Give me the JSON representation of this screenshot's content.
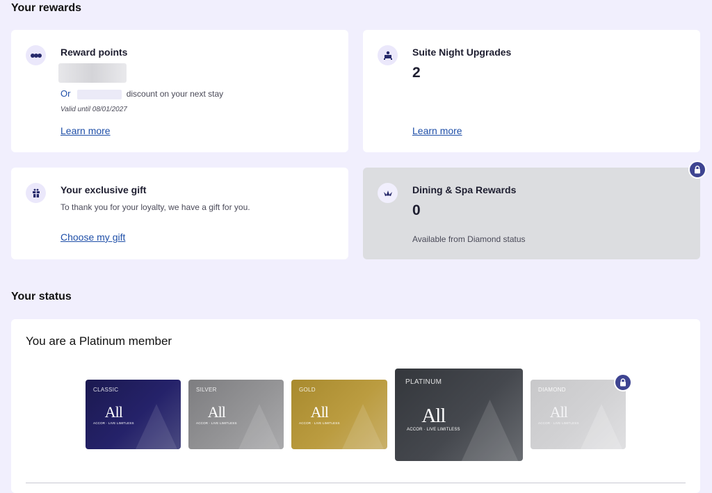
{
  "rewards": {
    "section_title": "Your rewards",
    "points": {
      "title": "Reward points",
      "or_label": "Or",
      "discount_text": "discount on your next stay",
      "valid_text": "Valid until 08/01/2027",
      "link": "Learn more"
    },
    "suite": {
      "title": "Suite Night Upgrades",
      "count": "2",
      "link": "Learn more"
    },
    "gift": {
      "title": "Your exclusive gift",
      "description": "To thank you for your loyalty, we have a gift for you.",
      "link": "Choose my gift"
    },
    "dining": {
      "title": "Dining & Spa Rewards",
      "count": "0",
      "note": "Available from Diamond status"
    }
  },
  "status": {
    "section_title": "Your status",
    "heading": "You are a Platinum member",
    "tiers": [
      {
        "name": "CLASSIC",
        "logo": "All",
        "tagline": "ACCOR · LIVE LIMITLESS"
      },
      {
        "name": "SILVER",
        "logo": "All",
        "tagline": "ACCOR · LIVE LIMITLESS"
      },
      {
        "name": "GOLD",
        "logo": "All",
        "tagline": "ACCOR · LIVE LIMITLESS"
      },
      {
        "name": "PLATINUM",
        "logo": "All",
        "tagline": "ACCOR · LIVE LIMITLESS"
      },
      {
        "name": "DIAMOND",
        "logo": "All",
        "tagline": "ACCOR · LIVE LIMITLESS"
      }
    ],
    "current_tier": "PLATINUM"
  },
  "colors": {
    "page_bg": "#f1effd",
    "link": "#1f4fa8",
    "lock_badge": "#3e4491",
    "classic": "#1f1c5c",
    "silver": "#8e8e90",
    "gold": "#b99a3a",
    "platinum": "#3f4248",
    "diamond": "#cfcfd1"
  },
  "icons": {
    "points": "points-icon",
    "suite": "bed-icon",
    "gift": "gift-icon",
    "dining": "lotus-icon",
    "lock": "lock-icon"
  }
}
